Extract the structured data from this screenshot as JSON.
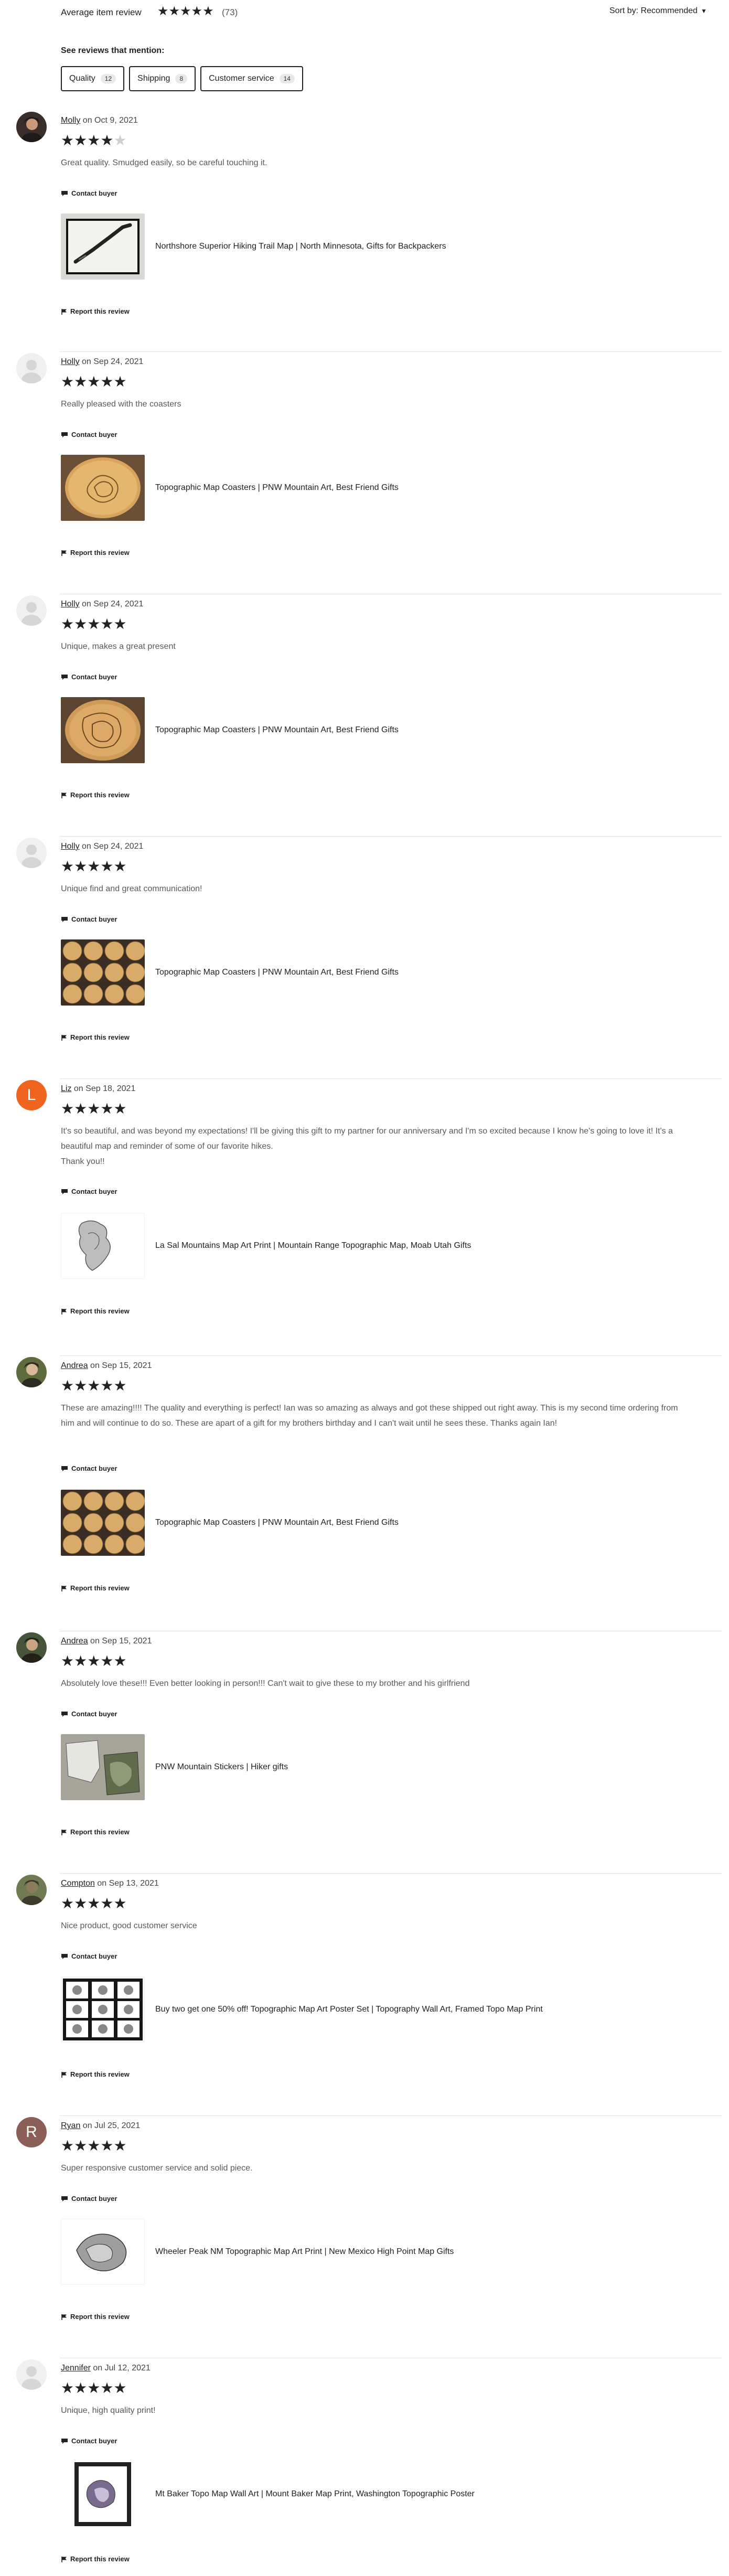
{
  "header": {
    "average_label": "Average item review",
    "average_rating": 5,
    "average_count": "(73)",
    "sort_label": "Sort by: Recommended"
  },
  "mentions": {
    "label": "See reviews that mention:",
    "chips": [
      {
        "label": "Quality",
        "count": "12"
      },
      {
        "label": "Shipping",
        "count": "8"
      },
      {
        "label": "Customer service",
        "count": "14"
      }
    ]
  },
  "labels": {
    "contact": "Contact buyer",
    "report": "Report this review"
  },
  "colors": {
    "orange_avatar": "#f1641e",
    "brown_avatar": "#8c5e58",
    "divider": "#e1e3df"
  },
  "reviews": [
    {
      "name": "Molly",
      "date": " on Oct 9, 2021",
      "rating": 4,
      "text": "Great quality. Smudged easily, so be careful touching it.",
      "listing": "Northshore Superior Hiking Trail Map | North Minnesota, Gifts for Backpackers"
    },
    {
      "name": "Holly",
      "date": " on Sep 24, 2021",
      "rating": 5,
      "text": "Really pleased with the coasters",
      "listing": "Topographic Map Coasters | PNW Mountain Art, Best Friend Gifts"
    },
    {
      "name": "Holly",
      "date": " on Sep 24, 2021",
      "rating": 5,
      "text": "Unique, makes a great present",
      "listing": "Topographic Map Coasters | PNW Mountain Art, Best Friend Gifts"
    },
    {
      "name": "Holly",
      "date": " on Sep 24, 2021",
      "rating": 5,
      "text": "Unique find and great communication!",
      "listing": "Topographic Map Coasters | PNW Mountain Art, Best Friend Gifts"
    },
    {
      "name": "Liz",
      "date": " on Sep 18, 2021",
      "rating": 5,
      "avatar_letter": "L",
      "text": "It's so beautiful, and was beyond my expectations! I'll be giving this gift to my partner for our anniversary and I'm so excited because I know he's going to love it! It's a beautiful map and reminder of some of our favorite hikes.\nThank you!!",
      "listing": "La Sal Mountains Map Art Print | Mountain Range Topographic Map, Moab Utah Gifts"
    },
    {
      "name": "Andrea",
      "date": " on Sep 15, 2021",
      "rating": 5,
      "text": "These are amazing!!!! The quality and everything is perfect! Ian was so amazing as always and got these shipped out right away. This is my second time ordering from him and will continue to do so. These are apart of a gift for my brothers birthday and I can't wait until he sees these. Thanks again Ian!",
      "listing": "Topographic Map Coasters | PNW Mountain Art, Best Friend Gifts"
    },
    {
      "name": "Andrea",
      "date": " on Sep 15, 2021",
      "rating": 5,
      "text": "Absolutely love these!!! Even better looking in person!!! Can't wait to give these to my brother and his girlfriend",
      "listing": "PNW Mountain Stickers | Hiker gifts"
    },
    {
      "name": "Compton",
      "date": " on Sep 13, 2021",
      "rating": 5,
      "text": "Nice product, good customer service",
      "listing": "Buy two get one 50% off! Topographic Map Art Poster Set | Topography Wall Art, Framed Topo Map Print"
    },
    {
      "name": "Ryan",
      "date": " on Jul 25, 2021",
      "rating": 5,
      "avatar_letter": "R",
      "text": "Super responsive customer service and solid piece.",
      "listing": "Wheeler Peak NM Topographic Map Art Print | New Mexico High Point Map Gifts"
    },
    {
      "name": "Jennifer",
      "date": " on Jul 12, 2021",
      "rating": 5,
      "text": "Unique, high quality print!",
      "listing": "Mt Baker Topo Map Wall Art | Mount Baker Map Print, Washington Topographic Poster"
    }
  ]
}
